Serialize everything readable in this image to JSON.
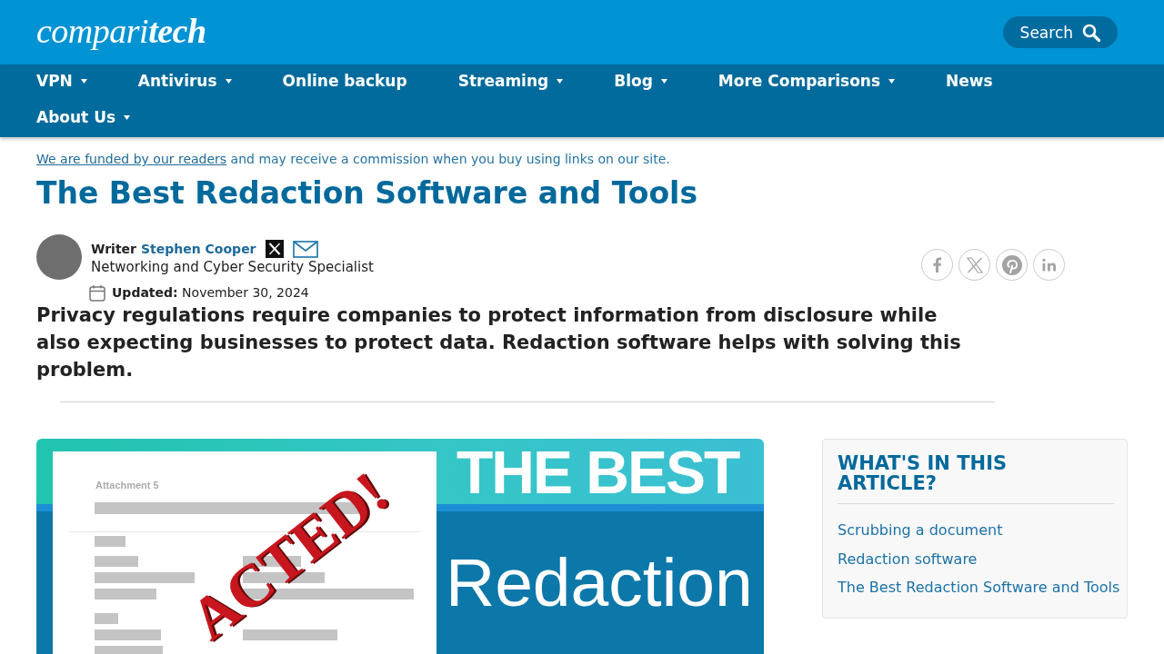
{
  "header": {
    "logo": "compari**tech**",
    "search_label": "Search"
  },
  "nav": [
    {
      "label": "VPN",
      "has_menu": true
    },
    {
      "label": "Antivirus",
      "has_menu": true
    },
    {
      "label": "Online backup",
      "has_menu": false
    },
    {
      "label": "Streaming",
      "has_menu": true
    },
    {
      "label": "Blog",
      "has_menu": true
    },
    {
      "label": "More Comparisons",
      "has_menu": true
    },
    {
      "label": "News",
      "has_menu": false
    },
    {
      "label": "About Us",
      "has_menu": true
    }
  ],
  "disclosure": {
    "link": "We are funded by our readers",
    "text": "and may receive a commission when you buy using links on our site."
  },
  "article": {
    "title": "The Best Redaction Software and Tools",
    "author": {
      "role": "Writer",
      "name": "Stephen Cooper",
      "title": "Networking and Cyber Security Specialist",
      "contact_icons": [
        {
          "kind": "x"
        },
        {
          "kind": "email"
        }
      ]
    },
    "updated": "**Updated:** November 30, 2024",
    "share_buttons": [
      {
        "kind": "facebook"
      },
      {
        "kind": "x"
      },
      {
        "kind": "pinterest"
      },
      {
        "kind": "linkedin"
      }
    ],
    "intro": "Privacy regulations require companies to protect information from disclosure while also expecting businesses to protect data. Redaction software helps with solving this problem."
  },
  "banner": {
    "headline": "THE BEST",
    "subject": "Redaction",
    "document_label": "Attachment 5",
    "stamp": "ACTED!"
  },
  "toc": {
    "title": "WHAT'S IN THIS ARTICLE?",
    "items": [
      "Scrubbing a document",
      "Redaction software",
      "The Best Redaction Software and Tools"
    ]
  }
}
